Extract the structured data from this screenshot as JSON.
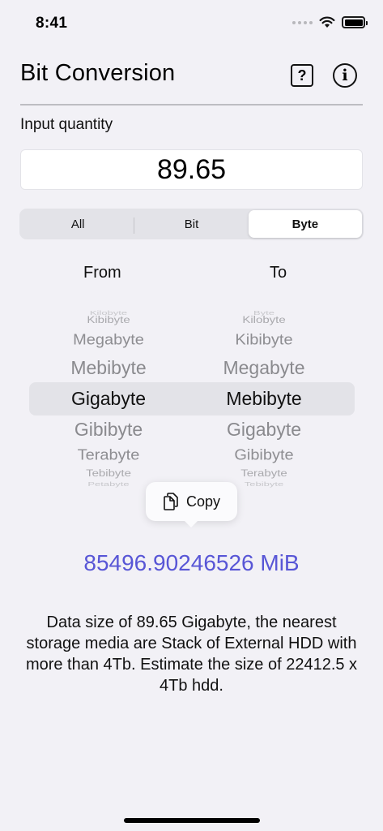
{
  "status_bar": {
    "time": "8:41"
  },
  "header": {
    "title": "Bit Conversion",
    "help_icon": "question-square-icon",
    "info_icon": "info-circle-icon"
  },
  "input": {
    "label": "Input quantity",
    "value": "89.65"
  },
  "segments": [
    {
      "label": "All",
      "selected": false
    },
    {
      "label": "Bit",
      "selected": false
    },
    {
      "label": "Byte",
      "selected": true
    }
  ],
  "picker": {
    "from_label": "From",
    "to_label": "To",
    "from_items": [
      "Kilobyte",
      "Kibibyte",
      "Megabyte",
      "Mebibyte",
      "Gigabyte",
      "Gibibyte",
      "Terabyte",
      "Tebibyte",
      "Petabyte"
    ],
    "from_selected": "Gigabyte",
    "to_items": [
      "Byte",
      "Kilobyte",
      "Kibibyte",
      "Megabyte",
      "Mebibyte",
      "Gigabyte",
      "Gibibyte",
      "Terabyte",
      "Tebibyte"
    ],
    "to_selected": "Mebibyte"
  },
  "copy_popup": {
    "label": "Copy",
    "icon": "copy-document-icon"
  },
  "result": "85496.90246526 MiB",
  "description": "Data size of 89.65 Gigabyte, the nearest storage media are Stack of External HDD with more than 4Tb. Estimate the size of 22412.5 x 4Tb hdd.",
  "colors": {
    "accent": "#5856d6",
    "background": "#f2f1f6"
  }
}
